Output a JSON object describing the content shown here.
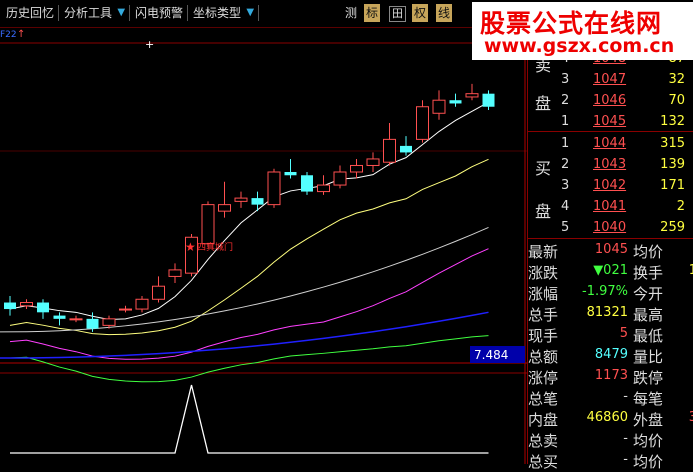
{
  "toolbar": {
    "history": "历史回忆",
    "analysis": "分析工具",
    "flash": "闪电预警",
    "coord": "坐标类型",
    "b_measure": "测",
    "b_label": "标",
    "b_grid": "田",
    "b_rights": "权",
    "b_line": "线"
  },
  "watermark": {
    "line1": "股票公式在线网",
    "line2": "www.gszx.com.cn"
  },
  "chart": {
    "corner_label": "F22",
    "signal_label": "四真城门",
    "price_box": "7.484",
    "colors": {
      "up": "#ff5050",
      "down": "#54ffff",
      "ma5": "#ffffff",
      "ma10": "#ffff7f",
      "ma20": "#ff40ff",
      "ma30": "#40ff40",
      "ma60": "#d0d0d0",
      "ma120": "#2020ff"
    }
  },
  "chart_data": {
    "type": "candlestick",
    "candles": [
      {
        "o": 10.12,
        "c": 10.1,
        "h": 10.14,
        "l": 10.08
      },
      {
        "o": 10.11,
        "c": 10.12,
        "h": 10.13,
        "l": 10.1
      },
      {
        "o": 10.12,
        "c": 10.09,
        "h": 10.13,
        "l": 10.07
      },
      {
        "o": 10.08,
        "c": 10.07,
        "h": 10.09,
        "l": 10.05
      },
      {
        "o": 10.07,
        "c": 10.07,
        "h": 10.08,
        "l": 10.06
      },
      {
        "o": 10.07,
        "c": 10.04,
        "h": 10.09,
        "l": 10.03
      },
      {
        "o": 10.05,
        "c": 10.07,
        "h": 10.08,
        "l": 10.04
      },
      {
        "o": 10.1,
        "c": 10.1,
        "h": 10.11,
        "l": 10.09
      },
      {
        "o": 10.1,
        "c": 10.13,
        "h": 10.14,
        "l": 10.09
      },
      {
        "o": 10.13,
        "c": 10.17,
        "h": 10.2,
        "l": 10.12
      },
      {
        "o": 10.2,
        "c": 10.22,
        "h": 10.24,
        "l": 10.18
      },
      {
        "o": 10.21,
        "c": 10.32,
        "h": 10.33,
        "l": 10.2
      },
      {
        "o": 10.3,
        "c": 10.42,
        "h": 10.43,
        "l": 10.29
      },
      {
        "o": 10.4,
        "c": 10.42,
        "h": 10.49,
        "l": 10.38
      },
      {
        "o": 10.43,
        "c": 10.44,
        "h": 10.46,
        "l": 10.41
      },
      {
        "o": 10.44,
        "c": 10.42,
        "h": 10.46,
        "l": 10.4
      },
      {
        "o": 10.42,
        "c": 10.52,
        "h": 10.53,
        "l": 10.41
      },
      {
        "o": 10.52,
        "c": 10.51,
        "h": 10.56,
        "l": 10.5
      },
      {
        "o": 10.51,
        "c": 10.46,
        "h": 10.52,
        "l": 10.45
      },
      {
        "o": 10.46,
        "c": 10.48,
        "h": 10.51,
        "l": 10.45
      },
      {
        "o": 10.48,
        "c": 10.52,
        "h": 10.54,
        "l": 10.47
      },
      {
        "o": 10.52,
        "c": 10.54,
        "h": 10.56,
        "l": 10.5
      },
      {
        "o": 10.54,
        "c": 10.56,
        "h": 10.58,
        "l": 10.52
      },
      {
        "o": 10.55,
        "c": 10.62,
        "h": 10.67,
        "l": 10.54
      },
      {
        "o": 10.6,
        "c": 10.58,
        "h": 10.63,
        "l": 10.57
      },
      {
        "o": 10.62,
        "c": 10.72,
        "h": 10.74,
        "l": 10.61
      },
      {
        "o": 10.7,
        "c": 10.74,
        "h": 10.77,
        "l": 10.68
      },
      {
        "o": 10.74,
        "c": 10.73,
        "h": 10.76,
        "l": 10.72
      },
      {
        "o": 10.75,
        "c": 10.76,
        "h": 10.79,
        "l": 10.74
      },
      {
        "o": 10.76,
        "c": 10.72,
        "h": 10.77,
        "l": 10.71
      }
    ],
    "indicator": [
      0,
      0,
      0,
      0,
      0,
      0,
      0,
      0,
      0,
      0,
      0,
      1,
      0,
      0,
      0,
      0,
      0,
      0,
      0,
      0,
      0,
      0,
      0,
      0,
      0,
      0,
      0,
      0,
      0,
      0
    ]
  },
  "quotes": {
    "sell_label": [
      "卖",
      "盘"
    ],
    "buy_label": [
      "买",
      "盘"
    ],
    "sell": [
      {
        "lvl": "4",
        "price": "1048",
        "vol": "87"
      },
      {
        "lvl": "3",
        "price": "1047",
        "vol": "32"
      },
      {
        "lvl": "2",
        "price": "1046",
        "vol": "70"
      },
      {
        "lvl": "1",
        "price": "1045",
        "vol": "132"
      }
    ],
    "buy": [
      {
        "lvl": "1",
        "price": "1044",
        "vol": "315"
      },
      {
        "lvl": "2",
        "price": "1043",
        "vol": "139"
      },
      {
        "lvl": "3",
        "price": "1042",
        "vol": "171"
      },
      {
        "lvl": "4",
        "price": "1041",
        "vol": "2"
      },
      {
        "lvl": "5",
        "price": "1040",
        "vol": "259"
      }
    ]
  },
  "stats": [
    {
      "l1": "最新",
      "v1": "1045",
      "c1": "#ff5050",
      "l2": "均价",
      "v2": "",
      "c2": "#ddd"
    },
    {
      "l1": "涨跌",
      "v1": "▼021",
      "c1": "#40ff40",
      "l2": "换手",
      "v2": "1",
      "c2": "#ffff40"
    },
    {
      "l1": "涨幅",
      "v1": "-1.97%",
      "c1": "#40ff40",
      "l2": "今开",
      "v2": "",
      "c2": "#ddd"
    },
    {
      "l1": "总手",
      "v1": "81321",
      "c1": "#ffff40",
      "l2": "最高",
      "v2": "",
      "c2": "#ddd"
    },
    {
      "l1": "现手",
      "v1": "5",
      "c1": "#ff5050",
      "l2": "最低",
      "v2": "",
      "c2": "#ddd"
    },
    {
      "l1": "总额",
      "v1": "8479",
      "c1": "#54ffff",
      "l2": "量比",
      "v2": "",
      "c2": "#ddd"
    },
    {
      "l1": "涨停",
      "v1": "1173",
      "c1": "#ff5050",
      "l2": "跌停",
      "v2": "",
      "c2": "#ddd"
    },
    {
      "l1": "总笔",
      "v1": "-",
      "c1": "#ddd",
      "l2": "每笔",
      "v2": "",
      "c2": "#ddd"
    },
    {
      "l1": "内盘",
      "v1": "46860",
      "c1": "#ffff40",
      "l2": "外盘",
      "v2": "3",
      "c2": "#ff5050"
    },
    {
      "l1": "总卖",
      "v1": "-",
      "c1": "#ddd",
      "l2": "均价",
      "v2": "",
      "c2": "#ddd"
    },
    {
      "l1": "总买",
      "v1": "-",
      "c1": "#ddd",
      "l2": "均价",
      "v2": "",
      "c2": "#ddd"
    }
  ]
}
